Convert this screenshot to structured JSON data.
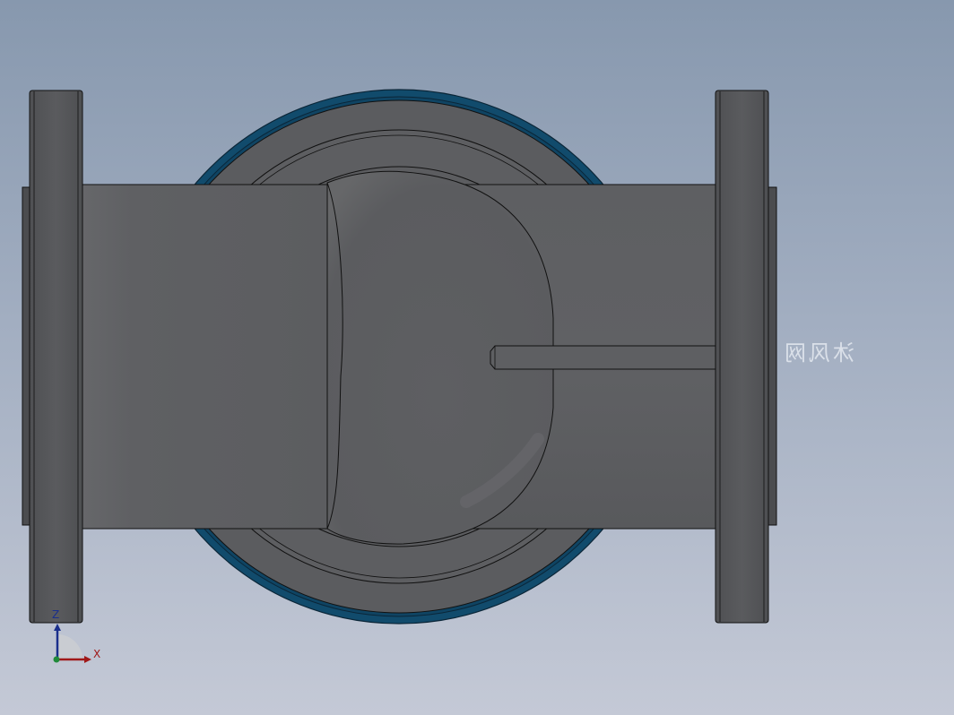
{
  "viewport": {
    "background_top": "#8798ae",
    "background_bottom": "#c4c9d6"
  },
  "model": {
    "body_color": "#5c5d60",
    "flange_color": "#555659",
    "seal_ring_color": "#114b6c",
    "edge_color": "#111111"
  },
  "watermark": {
    "text": "沐风网"
  },
  "triad": {
    "z_label": "Z",
    "x_label": "X",
    "z_color": "#1a2f8c",
    "x_color": "#a01818"
  }
}
